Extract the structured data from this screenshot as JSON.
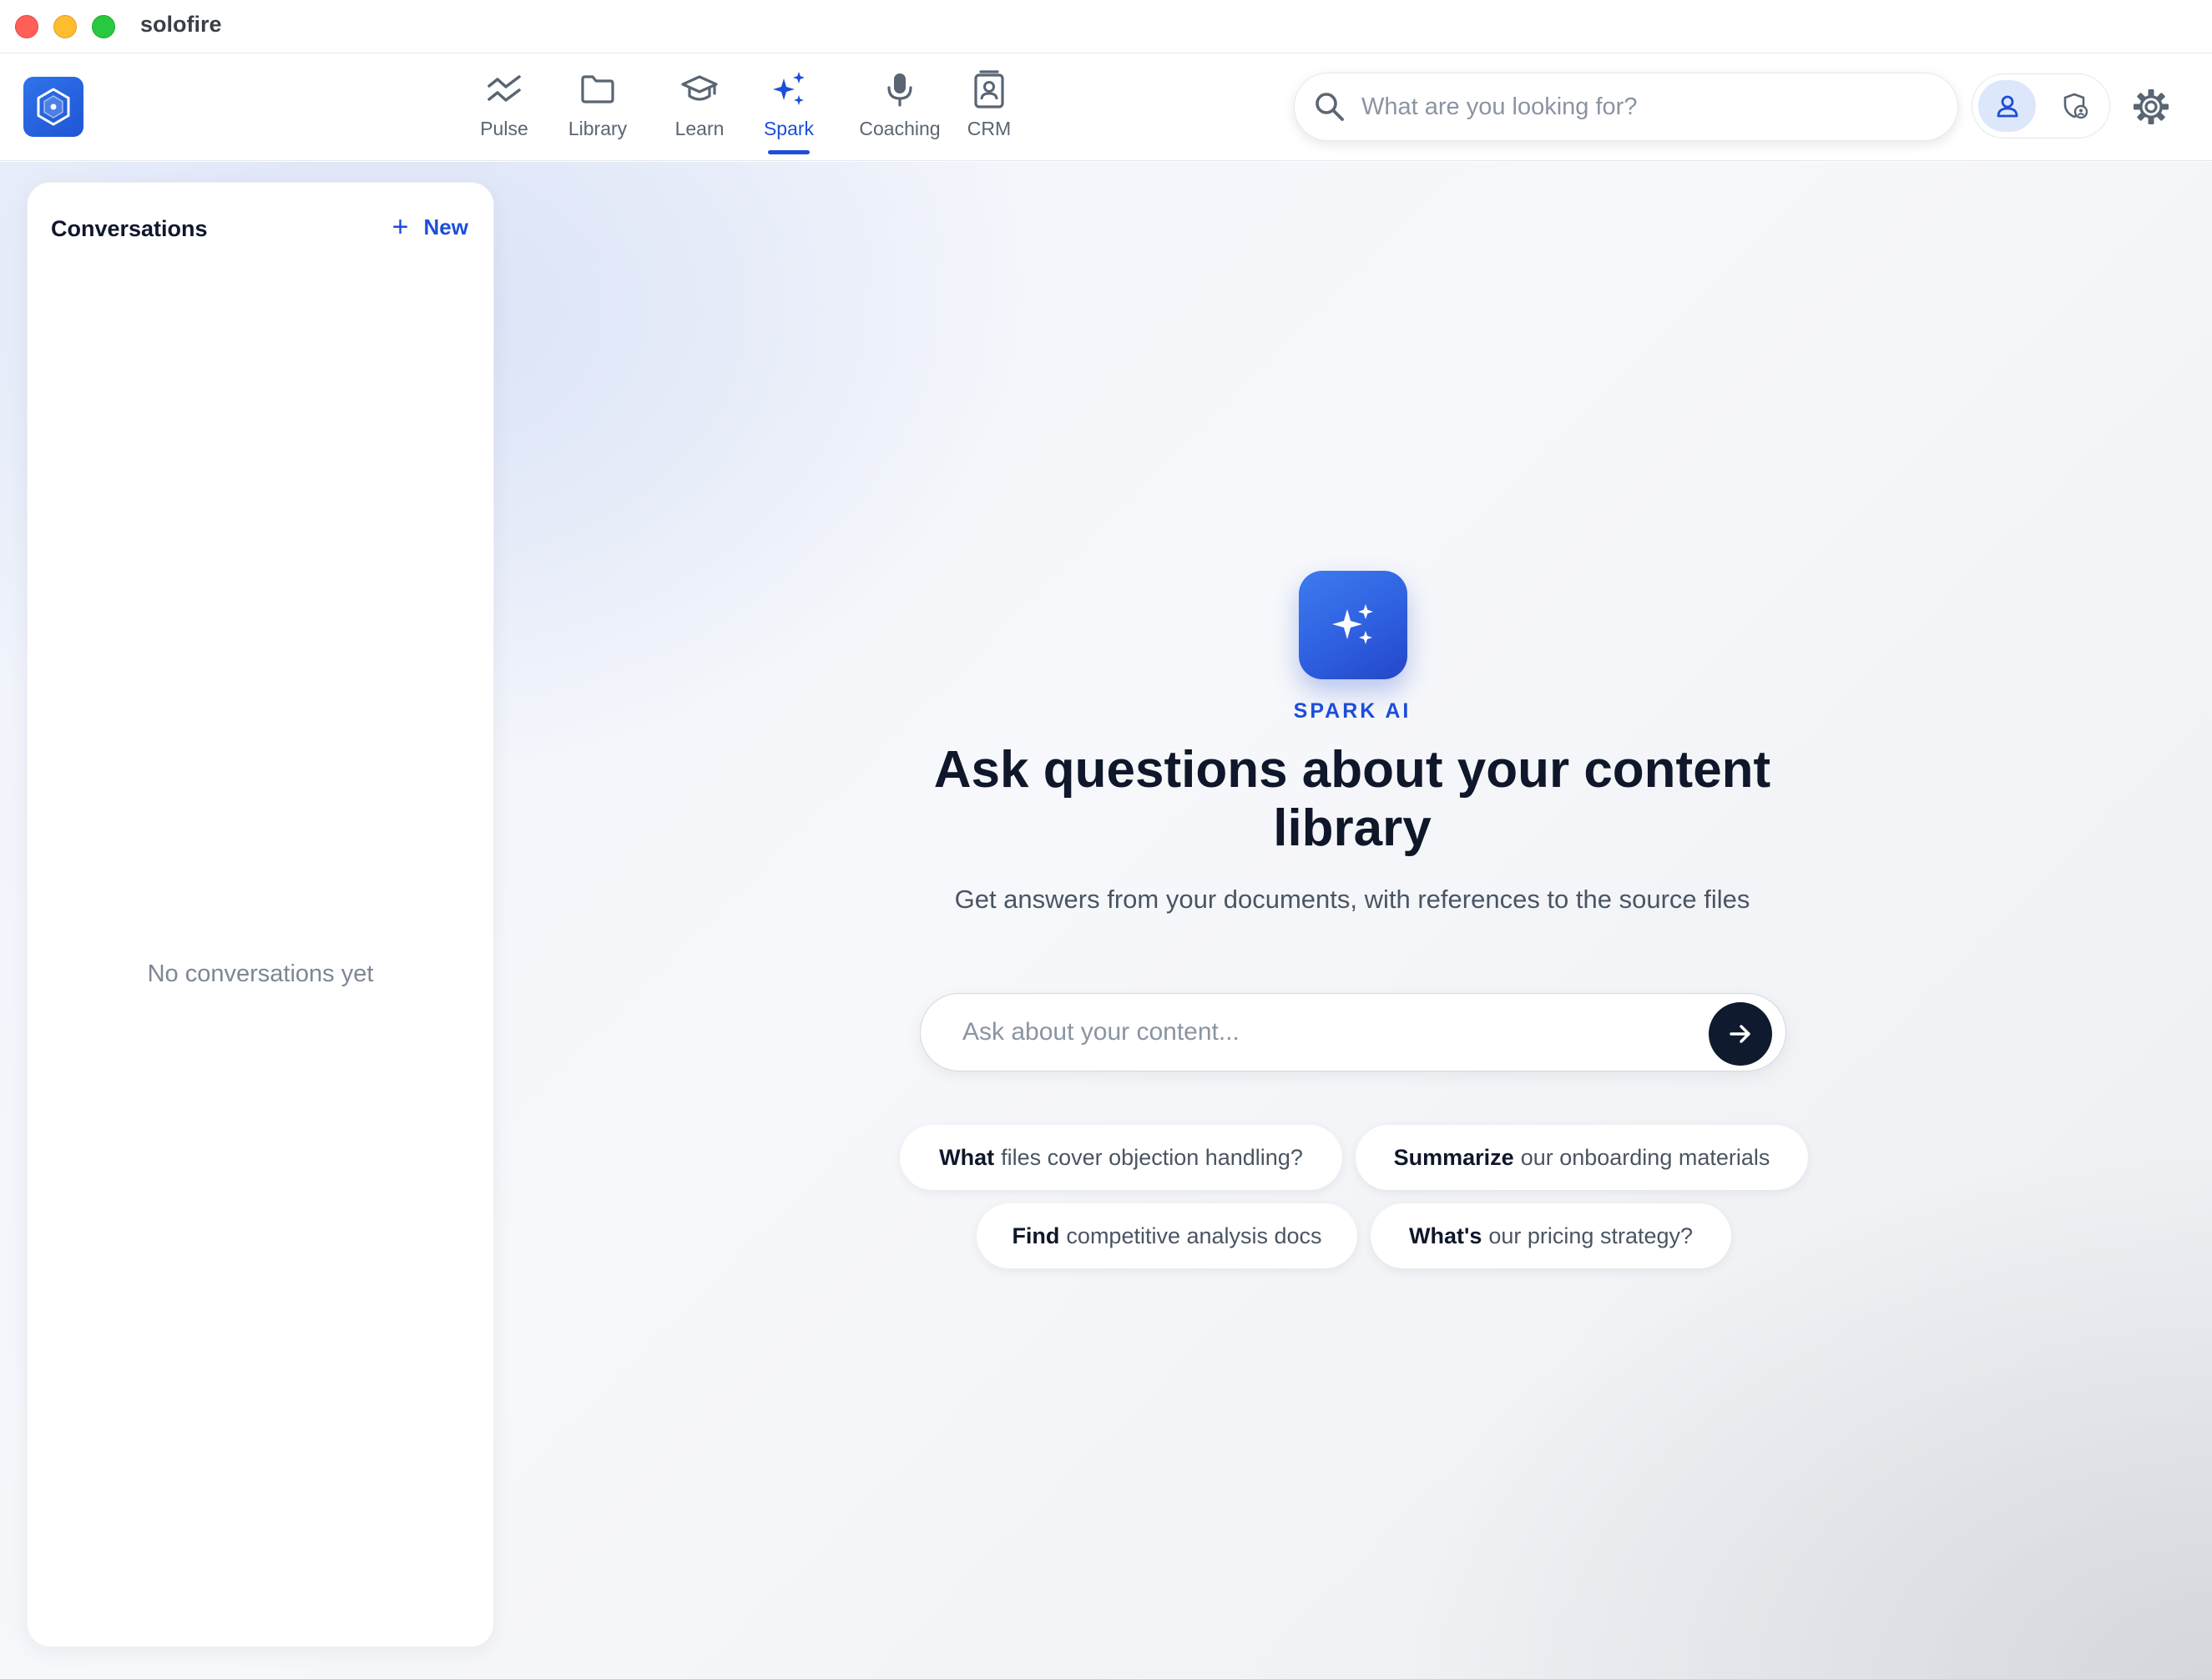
{
  "window": {
    "title": "solofire"
  },
  "nav": {
    "items": [
      {
        "label": "Pulse",
        "icon": "pulse-icon",
        "active": false
      },
      {
        "label": "Library",
        "icon": "folder-icon",
        "active": false
      },
      {
        "label": "Learn",
        "icon": "graduation-cap-icon",
        "active": false
      },
      {
        "label": "Spark",
        "icon": "sparkles-icon",
        "active": true
      },
      {
        "label": "Coaching",
        "icon": "microphone-icon",
        "active": false
      },
      {
        "label": "CRM",
        "icon": "contact-card-icon",
        "active": false
      }
    ]
  },
  "search": {
    "placeholder": "What are you looking for?"
  },
  "sidebar": {
    "title": "Conversations",
    "new_label": "New",
    "empty_text": "No conversations yet"
  },
  "hero": {
    "kicker": "SPARK AI",
    "title": "Ask questions about your content library",
    "subtitle": "Get answers from your documents, with references to the source files"
  },
  "ask": {
    "placeholder": "Ask about your content..."
  },
  "suggestions": [
    {
      "bold": "What",
      "rest": "files cover objection handling?"
    },
    {
      "bold": "Summarize",
      "rest": "our onboarding materials"
    },
    {
      "bold": "Find",
      "rest": "competitive analysis docs"
    },
    {
      "bold": "What's",
      "rest": "our pricing strategy?"
    }
  ],
  "colors": {
    "accent": "#1d4ed8",
    "send_button": "#0f1a2e"
  }
}
